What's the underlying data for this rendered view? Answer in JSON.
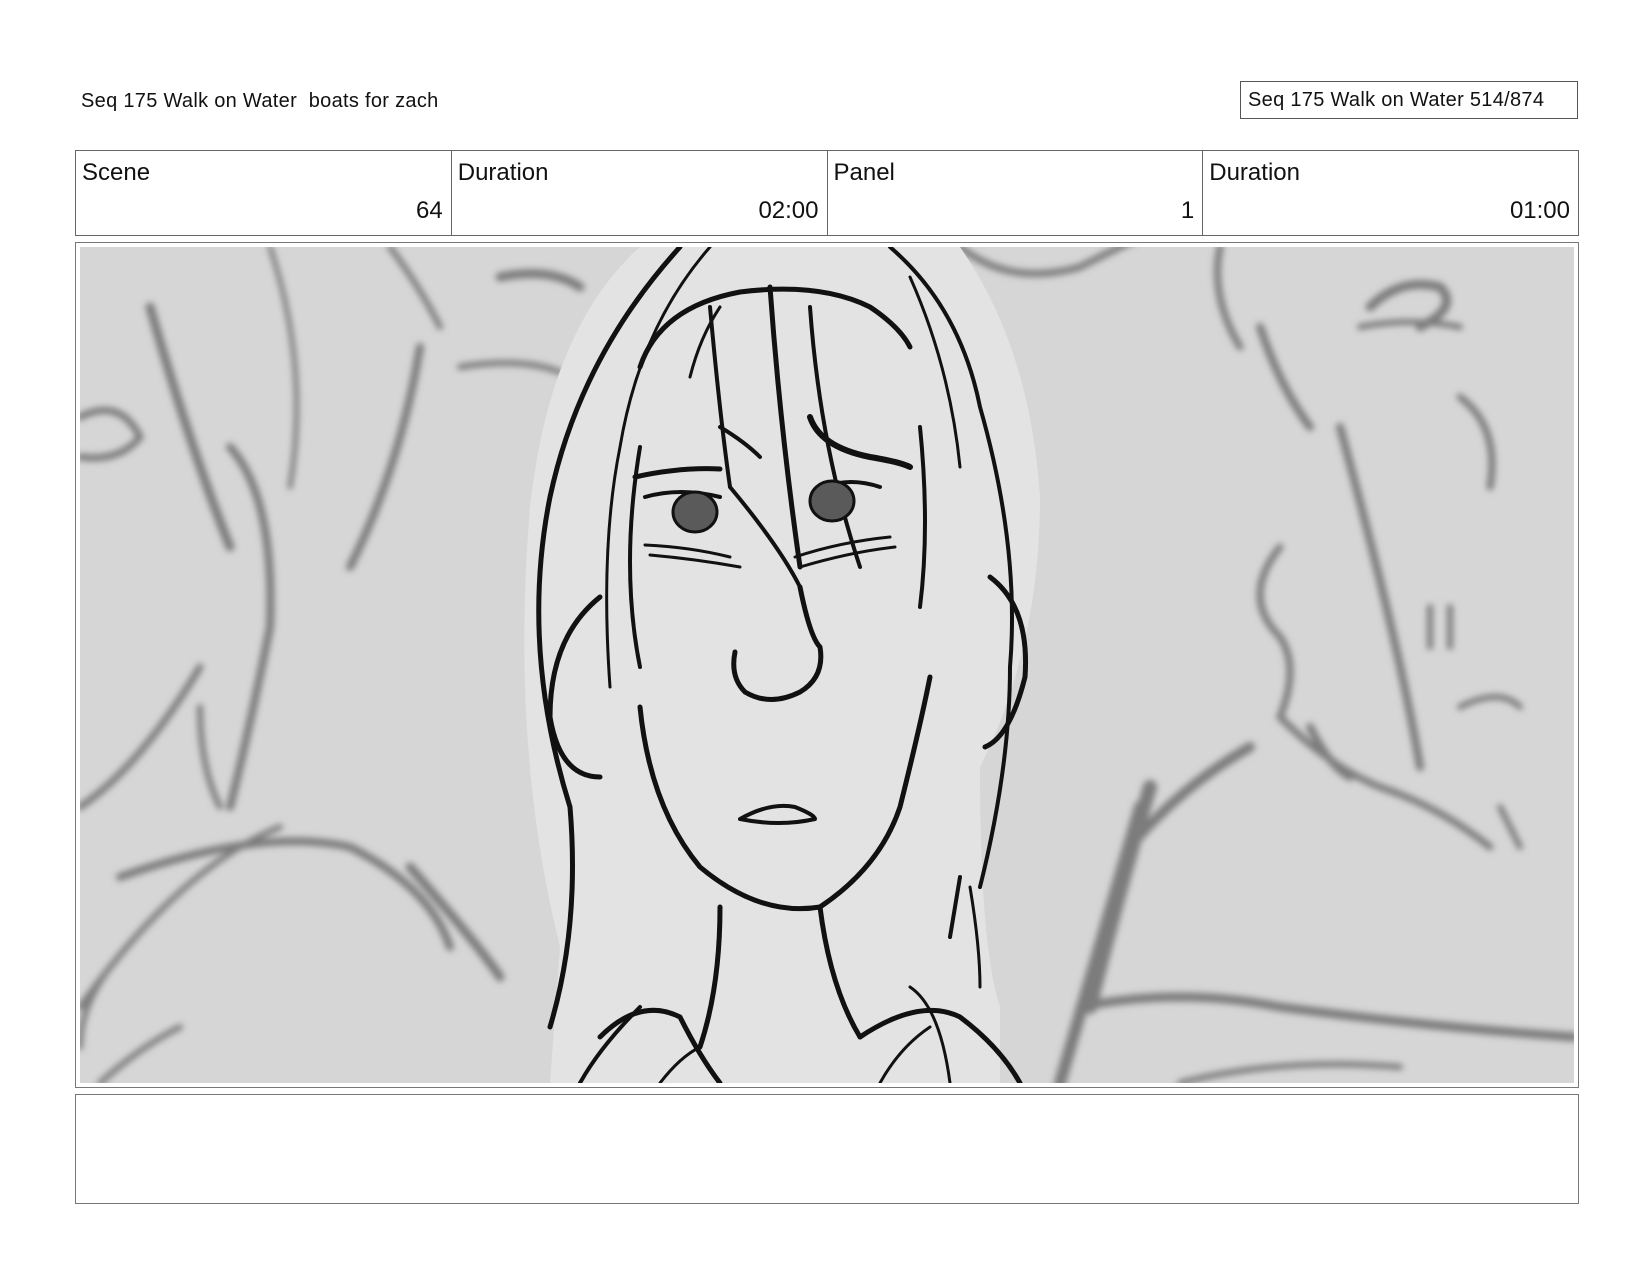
{
  "header": {
    "title": "Seq 175 Walk on Water  boats for zach",
    "page_counter": "Seq 175 Walk on Water 514/874"
  },
  "info_table": {
    "scene": {
      "label": "Scene",
      "value": "64"
    },
    "scene_duration": {
      "label": "Duration",
      "value": "02:00"
    },
    "panel": {
      "label": "Panel",
      "value": "1"
    },
    "panel_duration": {
      "label": "Duration",
      "value": "01:00"
    }
  },
  "panel_image": {
    "description_icon": "storyboard-sketch-icon",
    "background_color": "#d6d6d6",
    "foreground_color": "#e4e4e4",
    "line_color": "#111111",
    "blur_line_color": "#7a7a7a"
  },
  "notes": {
    "text": ""
  }
}
